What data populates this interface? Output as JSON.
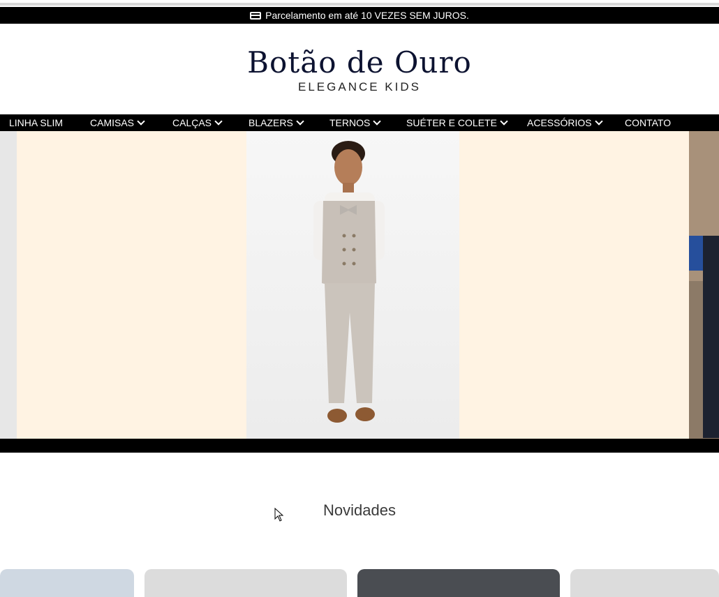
{
  "promo": {
    "text": "Parcelamento em até 10 VEZES SEM JUROS.",
    "icon": "credit-card-icon"
  },
  "logo": {
    "brand": "Botão de Ouro",
    "tagline": "ELEGANCE KIDS"
  },
  "nav": {
    "items": [
      {
        "label": "LINHA SLIM",
        "has_dropdown": false
      },
      {
        "label": "CAMISAS",
        "has_dropdown": true
      },
      {
        "label": "CALÇAS",
        "has_dropdown": true
      },
      {
        "label": "BLAZERS",
        "has_dropdown": true
      },
      {
        "label": "TERNOS",
        "has_dropdown": true
      },
      {
        "label": "SUÉTER E COLETE",
        "has_dropdown": true
      },
      {
        "label": "ACESSÓRIOS",
        "has_dropdown": true
      },
      {
        "label": "CONTATO",
        "has_dropdown": false
      }
    ]
  },
  "hero": {
    "background": "#fff3e3"
  },
  "section": {
    "title": "Novidades"
  },
  "colors": {
    "nav_bg": "#000000",
    "brand_text": "#0c1230"
  }
}
